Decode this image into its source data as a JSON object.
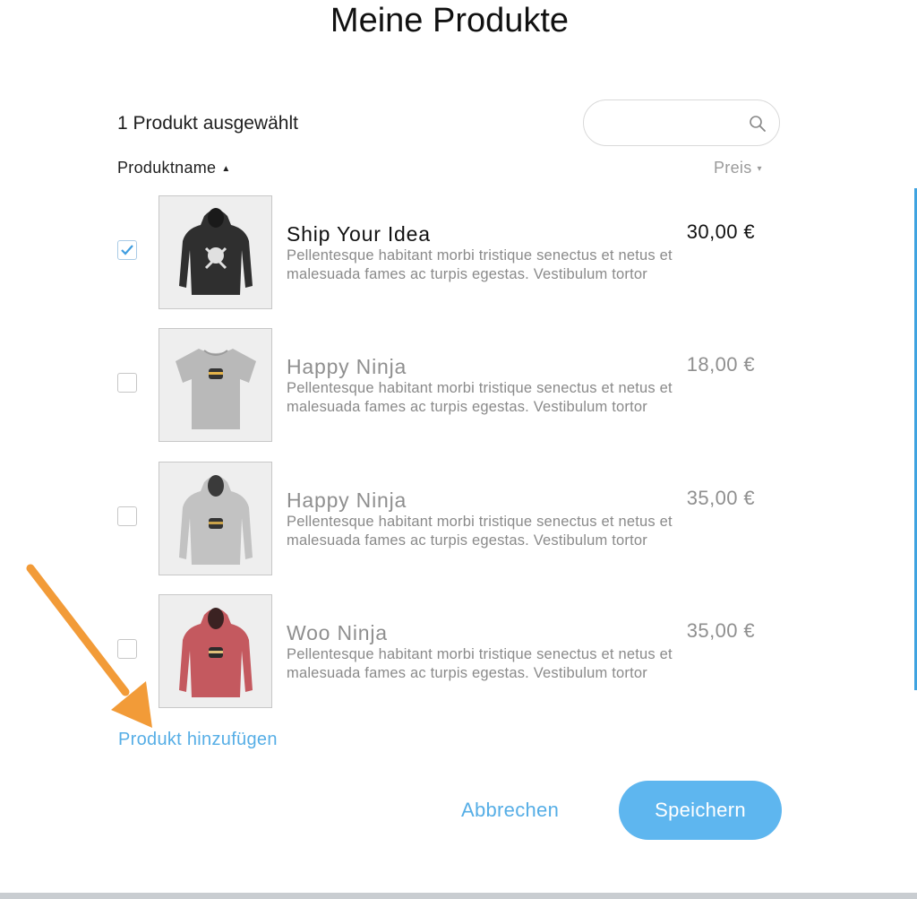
{
  "dialog": {
    "title": "Meine Produkte"
  },
  "toolbar": {
    "selected_count": "1 Produkt ausgewählt",
    "search_placeholder": ""
  },
  "columns": {
    "name": "Produktname",
    "name_sort": "▲",
    "price": "Preis",
    "price_sort": "▾"
  },
  "products": [
    {
      "name": "Ship Your Idea",
      "price": "30,00 €",
      "description": "Pellentesque habitant morbi tristique senectus et netus et malesuada fames ac turpis egestas. Vestibulum tortor",
      "checked": true,
      "thumb_icon": "black-hoodie-image",
      "thumb_color": "#2f2f2f"
    },
    {
      "name": "Happy Ninja",
      "price": "18,00 €",
      "description": "Pellentesque habitant morbi tristique senectus et netus et malesuada fames ac turpis egestas. Vestibulum tortor",
      "checked": false,
      "thumb_icon": "grey-tshirt-image",
      "thumb_color": "#b9b9b9"
    },
    {
      "name": "Happy Ninja",
      "price": "35,00 €",
      "description": "Pellentesque habitant morbi tristique senectus et netus et malesuada fames ac turpis egestas. Vestibulum tortor",
      "checked": false,
      "thumb_icon": "grey-hoodie-image",
      "thumb_color": "#c2c2c2"
    },
    {
      "name": "Woo Ninja",
      "price": "35,00 €",
      "description": "Pellentesque habitant morbi tristique senectus et netus et malesuada fames ac turpis egestas. Vestibulum tortor",
      "checked": false,
      "thumb_icon": "red-hoodie-image",
      "thumb_color": "#c4595f"
    }
  ],
  "footer": {
    "add_product": "Produkt hinzufügen",
    "cancel": "Abbrechen",
    "save": "Speichern"
  },
  "colors": {
    "accent": "#5eb6ef",
    "link": "#56aee6",
    "annotation_arrow": "#f29b38"
  }
}
